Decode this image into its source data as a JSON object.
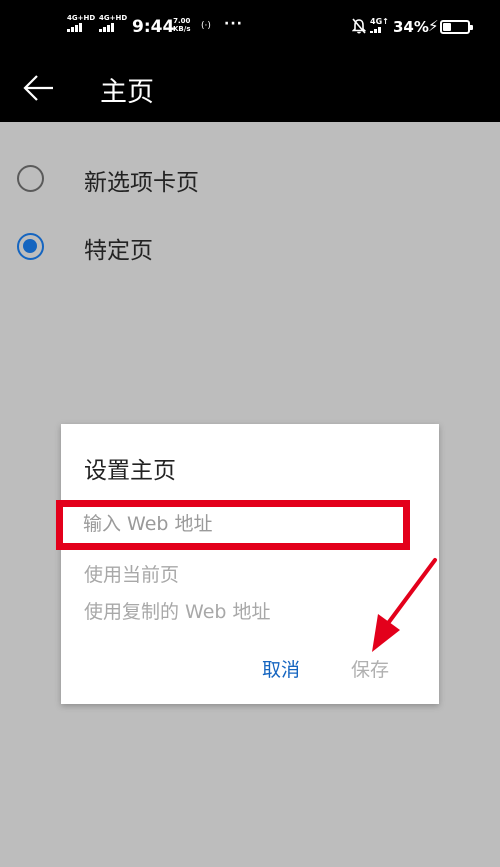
{
  "status_bar": {
    "network1": "4G+HD",
    "network2": "4G+HD",
    "time": "9:44",
    "speed_value": "7.00",
    "speed_unit": "KB/s",
    "hotspot": "(·)",
    "more": "···",
    "network3": "4G↑",
    "battery_text": "34%",
    "battery_level": 0.34
  },
  "app_bar": {
    "title": "主页"
  },
  "options": [
    {
      "label": "新选项卡页",
      "checked": false
    },
    {
      "label": "特定页",
      "checked": true
    }
  ],
  "dialog": {
    "title": "设置主页",
    "url_value": "",
    "url_placeholder": "输入 Web 地址",
    "use_current_page": "使用当前页",
    "use_copied_address": "使用复制的 Web 地址",
    "cancel_label": "取消",
    "save_label": "保存"
  },
  "colors": {
    "accent": "#1565c0",
    "annotation": "#e3001b",
    "overlay": "#bdbdbd",
    "bar": "#000000"
  }
}
